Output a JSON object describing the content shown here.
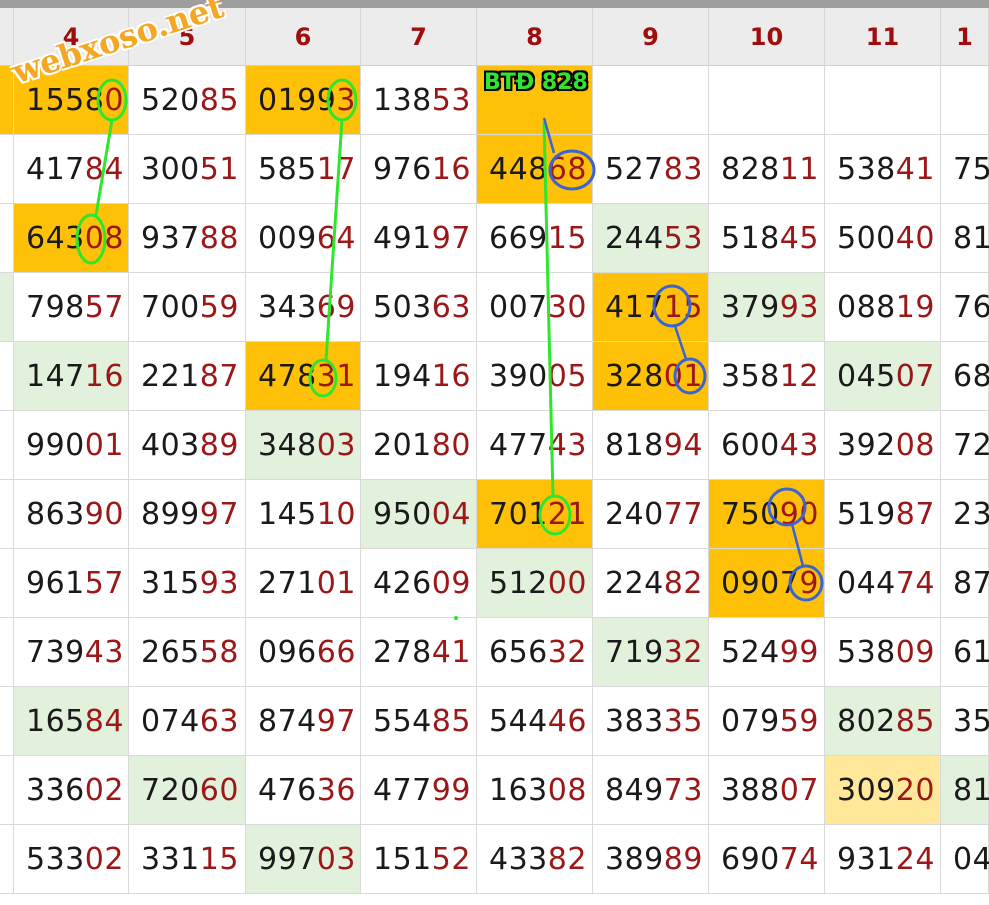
{
  "watermark": "webxoso.net",
  "annotation": {
    "label": "BTĐ 828"
  },
  "header": {
    "columns": [
      "",
      "4",
      "5",
      "6",
      "7",
      "8",
      "9",
      "10",
      "11",
      "1"
    ]
  },
  "rows": [
    {
      "cells": [
        {
          "lead": "",
          "tail": "",
          "hl": "orange"
        },
        {
          "lead": "1558",
          "tail": "0",
          "hl": "orange"
        },
        {
          "lead": "520",
          "tail": "85",
          "hl": ""
        },
        {
          "lead": "0199",
          "tail": "3",
          "hl": "orange"
        },
        {
          "lead": "138",
          "tail": "53",
          "hl": ""
        },
        {
          "lead": "",
          "tail": "",
          "hl": "orange"
        },
        {
          "lead": "",
          "tail": "",
          "hl": ""
        },
        {
          "lead": "",
          "tail": "",
          "hl": ""
        },
        {
          "lead": "",
          "tail": "",
          "hl": ""
        },
        {
          "lead": "",
          "tail": "",
          "hl": ""
        }
      ]
    },
    {
      "cells": [
        {
          "lead": "",
          "tail": "",
          "hl": ""
        },
        {
          "lead": "417",
          "tail": "84",
          "hl": ""
        },
        {
          "lead": "300",
          "tail": "51",
          "hl": ""
        },
        {
          "lead": "585",
          "tail": "17",
          "hl": ""
        },
        {
          "lead": "976",
          "tail": "16",
          "hl": ""
        },
        {
          "lead": "448",
          "tail": "68",
          "hl": "orange"
        },
        {
          "lead": "527",
          "tail": "83",
          "hl": ""
        },
        {
          "lead": "828",
          "tail": "11",
          "hl": ""
        },
        {
          "lead": "538",
          "tail": "41",
          "hl": ""
        },
        {
          "lead": "75",
          "tail": "",
          "hl": ""
        }
      ]
    },
    {
      "cells": [
        {
          "lead": "",
          "tail": "",
          "hl": ""
        },
        {
          "lead": "643",
          "tail": "08",
          "hl": "orange"
        },
        {
          "lead": "937",
          "tail": "88",
          "hl": ""
        },
        {
          "lead": "009",
          "tail": "64",
          "hl": ""
        },
        {
          "lead": "491",
          "tail": "97",
          "hl": ""
        },
        {
          "lead": "669",
          "tail": "15",
          "hl": ""
        },
        {
          "lead": "244",
          "tail": "53",
          "hl": "green"
        },
        {
          "lead": "518",
          "tail": "45",
          "hl": ""
        },
        {
          "lead": "500",
          "tail": "40",
          "hl": ""
        },
        {
          "lead": "81",
          "tail": "",
          "hl": ""
        }
      ]
    },
    {
      "cells": [
        {
          "lead": "",
          "tail": "",
          "hl": "green"
        },
        {
          "lead": "798",
          "tail": "57",
          "hl": ""
        },
        {
          "lead": "700",
          "tail": "59",
          "hl": ""
        },
        {
          "lead": "343",
          "tail": "69",
          "hl": ""
        },
        {
          "lead": "503",
          "tail": "63",
          "hl": ""
        },
        {
          "lead": "007",
          "tail": "30",
          "hl": ""
        },
        {
          "lead": "417",
          "tail": "15",
          "hl": "orange"
        },
        {
          "lead": "379",
          "tail": "93",
          "hl": "green"
        },
        {
          "lead": "088",
          "tail": "19",
          "hl": ""
        },
        {
          "lead": "76",
          "tail": "",
          "hl": ""
        }
      ]
    },
    {
      "cells": [
        {
          "lead": "",
          "tail": "",
          "hl": ""
        },
        {
          "lead": "147",
          "tail": "16",
          "hl": "green"
        },
        {
          "lead": "221",
          "tail": "87",
          "hl": ""
        },
        {
          "lead": "478",
          "tail": "31",
          "hl": "orange"
        },
        {
          "lead": "194",
          "tail": "16",
          "hl": ""
        },
        {
          "lead": "390",
          "tail": "05",
          "hl": ""
        },
        {
          "lead": "328",
          "tail": "01",
          "hl": "orange"
        },
        {
          "lead": "358",
          "tail": "12",
          "hl": ""
        },
        {
          "lead": "045",
          "tail": "07",
          "hl": "green"
        },
        {
          "lead": "68",
          "tail": "",
          "hl": ""
        }
      ]
    },
    {
      "cells": [
        {
          "lead": "",
          "tail": "",
          "hl": ""
        },
        {
          "lead": "990",
          "tail": "01",
          "hl": ""
        },
        {
          "lead": "403",
          "tail": "89",
          "hl": ""
        },
        {
          "lead": "348",
          "tail": "03",
          "hl": "green"
        },
        {
          "lead": "201",
          "tail": "80",
          "hl": ""
        },
        {
          "lead": "477",
          "tail": "43",
          "hl": ""
        },
        {
          "lead": "818",
          "tail": "94",
          "hl": ""
        },
        {
          "lead": "600",
          "tail": "43",
          "hl": ""
        },
        {
          "lead": "392",
          "tail": "08",
          "hl": ""
        },
        {
          "lead": "72",
          "tail": "",
          "hl": ""
        }
      ]
    },
    {
      "cells": [
        {
          "lead": "",
          "tail": "",
          "hl": ""
        },
        {
          "lead": "863",
          "tail": "90",
          "hl": ""
        },
        {
          "lead": "899",
          "tail": "97",
          "hl": ""
        },
        {
          "lead": "145",
          "tail": "10",
          "hl": ""
        },
        {
          "lead": "950",
          "tail": "04",
          "hl": "green"
        },
        {
          "lead": "701",
          "tail": "21",
          "hl": "orange"
        },
        {
          "lead": "240",
          "tail": "77",
          "hl": ""
        },
        {
          "lead": "750",
          "tail": "90",
          "hl": "orange"
        },
        {
          "lead": "519",
          "tail": "87",
          "hl": ""
        },
        {
          "lead": "23",
          "tail": "",
          "hl": ""
        }
      ]
    },
    {
      "cells": [
        {
          "lead": "",
          "tail": "",
          "hl": ""
        },
        {
          "lead": "961",
          "tail": "57",
          "hl": ""
        },
        {
          "lead": "315",
          "tail": "93",
          "hl": ""
        },
        {
          "lead": "271",
          "tail": "01",
          "hl": ""
        },
        {
          "lead": "426",
          "tail": "09",
          "hl": ""
        },
        {
          "lead": "512",
          "tail": "00",
          "hl": "green"
        },
        {
          "lead": "224",
          "tail": "82",
          "hl": ""
        },
        {
          "lead": "0907",
          "tail": "9",
          "hl": "orange"
        },
        {
          "lead": "044",
          "tail": "74",
          "hl": ""
        },
        {
          "lead": "87",
          "tail": "",
          "hl": ""
        }
      ]
    },
    {
      "cells": [
        {
          "lead": "",
          "tail": "",
          "hl": ""
        },
        {
          "lead": "739",
          "tail": "43",
          "hl": ""
        },
        {
          "lead": "265",
          "tail": "58",
          "hl": ""
        },
        {
          "lead": "096",
          "tail": "66",
          "hl": ""
        },
        {
          "lead": "278",
          "tail": "41",
          "hl": ""
        },
        {
          "lead": "656",
          "tail": "32",
          "hl": ""
        },
        {
          "lead": "719",
          "tail": "32",
          "hl": "green"
        },
        {
          "lead": "524",
          "tail": "99",
          "hl": ""
        },
        {
          "lead": "538",
          "tail": "09",
          "hl": ""
        },
        {
          "lead": "61",
          "tail": "",
          "hl": ""
        }
      ]
    },
    {
      "cells": [
        {
          "lead": "",
          "tail": "",
          "hl": ""
        },
        {
          "lead": "165",
          "tail": "84",
          "hl": "green"
        },
        {
          "lead": "074",
          "tail": "63",
          "hl": ""
        },
        {
          "lead": "874",
          "tail": "97",
          "hl": ""
        },
        {
          "lead": "554",
          "tail": "85",
          "hl": ""
        },
        {
          "lead": "544",
          "tail": "46",
          "hl": ""
        },
        {
          "lead": "383",
          "tail": "35",
          "hl": ""
        },
        {
          "lead": "079",
          "tail": "59",
          "hl": ""
        },
        {
          "lead": "802",
          "tail": "85",
          "hl": "green"
        },
        {
          "lead": "35",
          "tail": "",
          "hl": ""
        }
      ]
    },
    {
      "cells": [
        {
          "lead": "",
          "tail": "",
          "hl": ""
        },
        {
          "lead": "336",
          "tail": "02",
          "hl": ""
        },
        {
          "lead": "720",
          "tail": "60",
          "hl": "green"
        },
        {
          "lead": "476",
          "tail": "36",
          "hl": ""
        },
        {
          "lead": "477",
          "tail": "99",
          "hl": ""
        },
        {
          "lead": "163",
          "tail": "08",
          "hl": ""
        },
        {
          "lead": "849",
          "tail": "73",
          "hl": ""
        },
        {
          "lead": "388",
          "tail": "07",
          "hl": ""
        },
        {
          "lead": "309",
          "tail": "20",
          "hl": "yellow"
        },
        {
          "lead": "81",
          "tail": "",
          "hl": "green"
        }
      ]
    },
    {
      "cells": [
        {
          "lead": "",
          "tail": "",
          "hl": ""
        },
        {
          "lead": "533",
          "tail": "02",
          "hl": ""
        },
        {
          "lead": "331",
          "tail": "15",
          "hl": ""
        },
        {
          "lead": "997",
          "tail": "03",
          "hl": "green"
        },
        {
          "lead": "151",
          "tail": "52",
          "hl": ""
        },
        {
          "lead": "433",
          "tail": "82",
          "hl": ""
        },
        {
          "lead": "389",
          "tail": "89",
          "hl": ""
        },
        {
          "lead": "690",
          "tail": "74",
          "hl": ""
        },
        {
          "lead": "931",
          "tail": "24",
          "hl": ""
        },
        {
          "lead": "04",
          "tail": "",
          "hl": ""
        }
      ]
    }
  ]
}
